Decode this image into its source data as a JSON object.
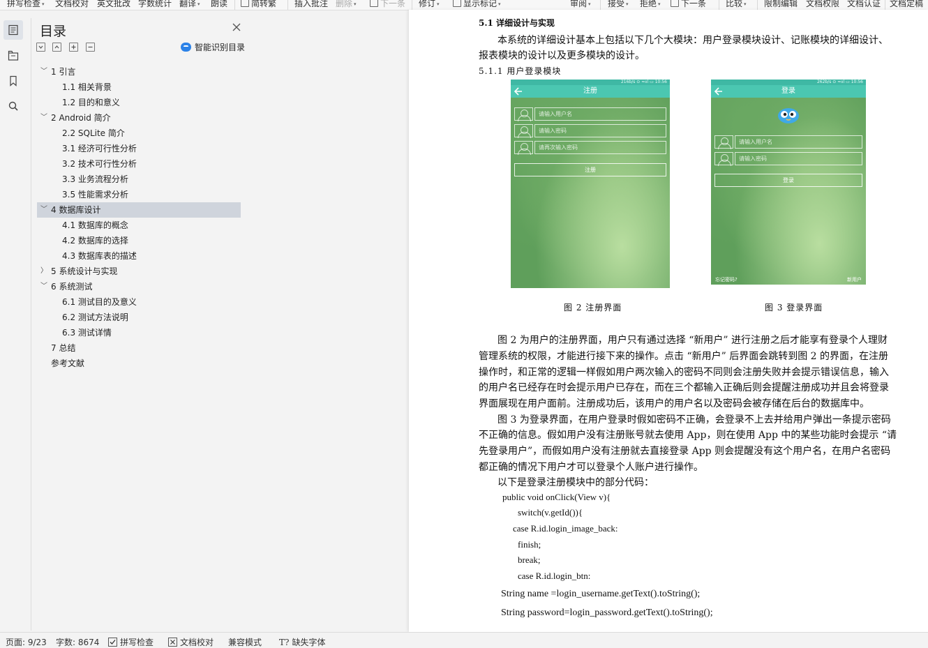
{
  "ribbon": {
    "items": [
      {
        "label": "拼写检查",
        "dropdown": true
      },
      {
        "label": "文档校对",
        "dropdown": false
      },
      {
        "label": "英文批改",
        "dropdown": false
      },
      {
        "label": "字数统计",
        "dropdown": false
      },
      {
        "label": "翻译",
        "dropdown": true
      },
      {
        "label": "朗读",
        "dropdown": false
      },
      {
        "label": "简转繁",
        "dropdown": false
      },
      {
        "label": "插入批注",
        "dropdown": false
      },
      {
        "label": "删除",
        "dropdown": true
      },
      {
        "label": "下一条",
        "dropdown": false
      },
      {
        "label": "修订",
        "dropdown": true
      },
      {
        "label": "显示标记",
        "dropdown": true
      },
      {
        "label": "审阅",
        "dropdown": true
      },
      {
        "label": "接受",
        "dropdown": true
      },
      {
        "label": "拒绝",
        "dropdown": true
      },
      {
        "label": "下一条",
        "dropdown": false
      },
      {
        "label": "比较",
        "dropdown": true
      },
      {
        "label": "限制编辑",
        "dropdown": false
      },
      {
        "label": "文档权限",
        "dropdown": false
      },
      {
        "label": "文档认证",
        "dropdown": false
      },
      {
        "label": "文档定稿",
        "dropdown": false
      }
    ]
  },
  "rail": {
    "icons": [
      "toc-icon",
      "navigation-icon",
      "bookmark-icon",
      "search-icon"
    ]
  },
  "toc": {
    "title": "目录",
    "ai_label": "智能识别目录",
    "items": [
      {
        "label": "1 引言",
        "level": 1,
        "arrow": "expanded"
      },
      {
        "label": "1.1  相关背景",
        "level": 2,
        "arrow": ""
      },
      {
        "label": "1.2  目的和意义",
        "level": 2,
        "arrow": ""
      },
      {
        "label": "2 Android 简介",
        "level": 1,
        "arrow": "expanded"
      },
      {
        "label": "2.2 SQLite 简介",
        "level": 2,
        "arrow": ""
      },
      {
        "label": "3.1 经济可行性分析",
        "level": 2,
        "arrow": ""
      },
      {
        "label": "3.2 技术可行性分析",
        "level": 2,
        "arrow": ""
      },
      {
        "label": "3.3 业务流程分析",
        "level": 2,
        "arrow": ""
      },
      {
        "label": "3.5 性能需求分析",
        "level": 2,
        "arrow": ""
      },
      {
        "label": "4  数据库设计",
        "level": 1,
        "arrow": "expanded",
        "selected": true
      },
      {
        "label": "4.1  数据库的概念",
        "level": 2,
        "arrow": ""
      },
      {
        "label": "4.2  数据库的选择",
        "level": 2,
        "arrow": ""
      },
      {
        "label": "4.3  数据库表的描述",
        "level": 2,
        "arrow": ""
      },
      {
        "label": "5 系统设计与实现",
        "level": 1,
        "arrow": "collapsed"
      },
      {
        "label": "6 系统测试",
        "level": 1,
        "arrow": "expanded"
      },
      {
        "label": "6.1 测试目的及意义",
        "level": 2,
        "arrow": ""
      },
      {
        "label": "6.2 测试方法说明",
        "level": 2,
        "arrow": ""
      },
      {
        "label": "6.3 测试详情",
        "level": 2,
        "arrow": ""
      },
      {
        "label": "7 总结",
        "level": 1,
        "arrow": ""
      },
      {
        "label": "参考文献",
        "level": 1,
        "arrow": ""
      }
    ]
  },
  "doc": {
    "heading": "5.1 详细设计与实现",
    "intro_1": "本系统的详细设计基本上包括以下几个大模块：用户登录模块设计、记账模块的详细设计、",
    "intro_2": "报表模块的设计以及更多模块的设计。",
    "subheading": "5.1.1 用户登录模块",
    "fig2": {
      "status": "216b/s ⊙ ≈ııl ▭ 10:56",
      "title": "注册",
      "fields": [
        "请输入用户名",
        "请输入密码",
        "请再次输入密码"
      ],
      "button": "注册",
      "caption": "图 2  注册界面"
    },
    "fig3": {
      "status": "262b/s ⊙ ≈ııl ▭ 10:56",
      "title": "登录",
      "fields": [
        "请输入用户名",
        "请输入密码"
      ],
      "button": "登录",
      "forgot": "忘记密码?",
      "new_user": "新用户",
      "caption": "图 3  登录界面"
    },
    "para": [
      "图 2 为用户的注册界面，用户只有通过选择 “新用户” 进行注册之后才能享有登录个人理财",
      "管理系统的权限，才能进行接下来的操作。点击 “新用户” 后界面会跳转到图 2 的界面，在注册",
      "操作时，和正常的逻辑一样假如用户两次输入的密码不同则会注册失败并会提示错误信息，输入",
      "的用户名已经存在时会提示用户已存在，而在三个都输入正确后则会提醒注册成功并且会将登录",
      "界面展现在用户面前。注册成功后，该用户的用户名以及密码会被存储在后台的数据库中。",
      "图 3 为登录界面，在用户登录时假如密码不正确，会登录不上去并给用户弹出一条提示密码",
      "不正确的信息。假如用户没有注册账号就去使用 App，则在使用 App 中的某些功能时会提示 “请",
      "先登录用户”，而假如用户没有注册就去直接登录 App 则会提醒没有这个用户名，在用户名密码",
      "都正确的情况下用户才可以登录个人账户进行操作。",
      "以下是登录注册模块中的部分代码："
    ],
    "code": [
      "public void onClick(View v){",
      "switch(v.getId()){",
      "case R.id.login_image_back:",
      "finish;",
      "break;",
      "case R.id.login_btn:",
      "String name =login_username.getText().toString();",
      "String password=login_password.getText().toString();"
    ]
  },
  "status": {
    "page": "页面: 9/23",
    "words": "字数: 8674",
    "spell": "拼写检查",
    "proof": "文档校对",
    "compat": "兼容模式",
    "font": "缺失字体"
  }
}
